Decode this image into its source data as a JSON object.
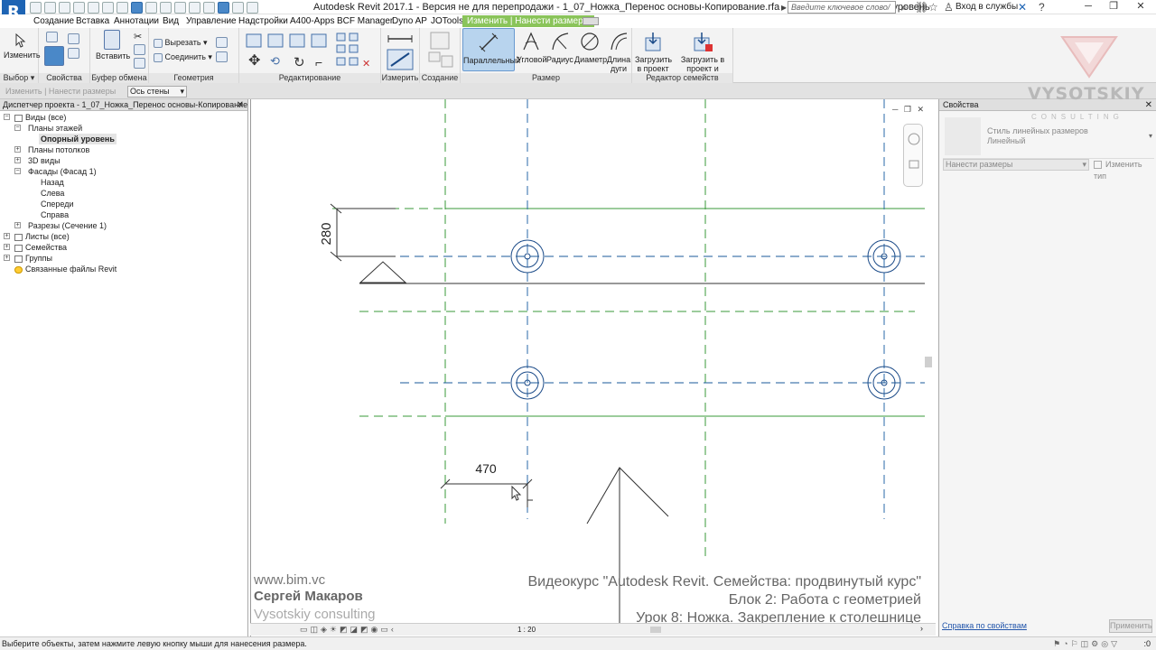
{
  "window": {
    "title": "Autodesk Revit 2017.1 - Версия не для перепродажи -    1_07_Ножка_Перенос основы-Копирование.rfa - План этажа: Опорный уровень",
    "search_placeholder": "Введите ключевое слово/фразу",
    "signin": "Вход в службы",
    "app_letter": "R"
  },
  "tabs": [
    "Создание",
    "Вставка",
    "Аннотации",
    "Вид",
    "Управление",
    "Надстройки",
    "A400-Apps",
    "BCF Manager",
    "Dyno AP",
    "JOTools",
    "Изменить | Нанести размеры"
  ],
  "ribbon": {
    "select": {
      "title": "Выбор",
      "modify": "Изменить"
    },
    "properties": {
      "title": "Свойства"
    },
    "clipboard": {
      "title": "Буфер обмена",
      "paste": "Вставить"
    },
    "geometry": {
      "title": "Геометрия",
      "cut": "Вырезать",
      "join": "Соединить"
    },
    "modify": {
      "title": "Редактирование"
    },
    "measure": {
      "title": "Измерить"
    },
    "create": {
      "title": "Создание"
    },
    "dimension": {
      "title": "Размер",
      "buttons": [
        {
          "label": "Параллельный"
        },
        {
          "label": "Угловой"
        },
        {
          "label": "Радиус"
        },
        {
          "label": "Диаметр"
        },
        {
          "label": "Длина",
          "label2": "дуги"
        }
      ]
    },
    "family_editor": {
      "title": "Редактор семейств",
      "load": "Загрузить",
      "load2": "в проект",
      "load_close": "Загрузить в",
      "load_close2": "проект и закрыть"
    }
  },
  "options_bar": {
    "context": "Изменить | Нанести размеры",
    "pick": "Ось стены"
  },
  "browser": {
    "title": "Диспетчер проекта - 1_07_Ножка_Перенос основы-Копирование.rfa",
    "nodes": [
      {
        "label": "Виды (все)"
      },
      {
        "label": "Планы этажей"
      },
      {
        "label": "Опорный уровень"
      },
      {
        "label": "Планы потолков"
      },
      {
        "label": "3D виды"
      },
      {
        "label": "Фасады (Фасад 1)"
      },
      {
        "label": "Назад"
      },
      {
        "label": "Слева"
      },
      {
        "label": "Спереди"
      },
      {
        "label": "Справа"
      },
      {
        "label": "Разрезы (Сечение 1)"
      },
      {
        "label": "Листы (все)"
      },
      {
        "label": "Семейства"
      },
      {
        "label": "Группы"
      },
      {
        "label": "Связанные файлы Revit"
      }
    ]
  },
  "canvas": {
    "dim_vertical": "280",
    "dim_horizontal": "470",
    "scale": "1 : 20",
    "watermark_left": [
      "www.bim.vc",
      "Сергей Макаров",
      "Vysotskiy consulting"
    ],
    "watermark_right": [
      "Видеокурс \"Autodesk Revit. Семейства: продвинутый курс\"",
      "Блок 2: Работа с геометрией",
      "Урок 8: Ножка. Закрепление к столешнице"
    ]
  },
  "properties": {
    "title": "Свойства",
    "type_line1": "Стиль линейных размеров",
    "type_line2": "Линейный",
    "filter": "Нанести размеры",
    "edit_type": "Изменить тип",
    "help": "Справка по свойствам",
    "apply": "Применить"
  },
  "logo": {
    "name": "VYSOTSKIY",
    "sub": "CONSULTING"
  },
  "status": {
    "text": "Выберите объекты, затем нажмите левую кнопку мыши для нанесения размера.",
    "selection_count": ":0"
  },
  "colors": {
    "accent_tab": "#8ac45a",
    "grid_green": "#3a9a3a",
    "ref_blue": "#2a6aa8",
    "revit_blue": "#1e64b4"
  }
}
